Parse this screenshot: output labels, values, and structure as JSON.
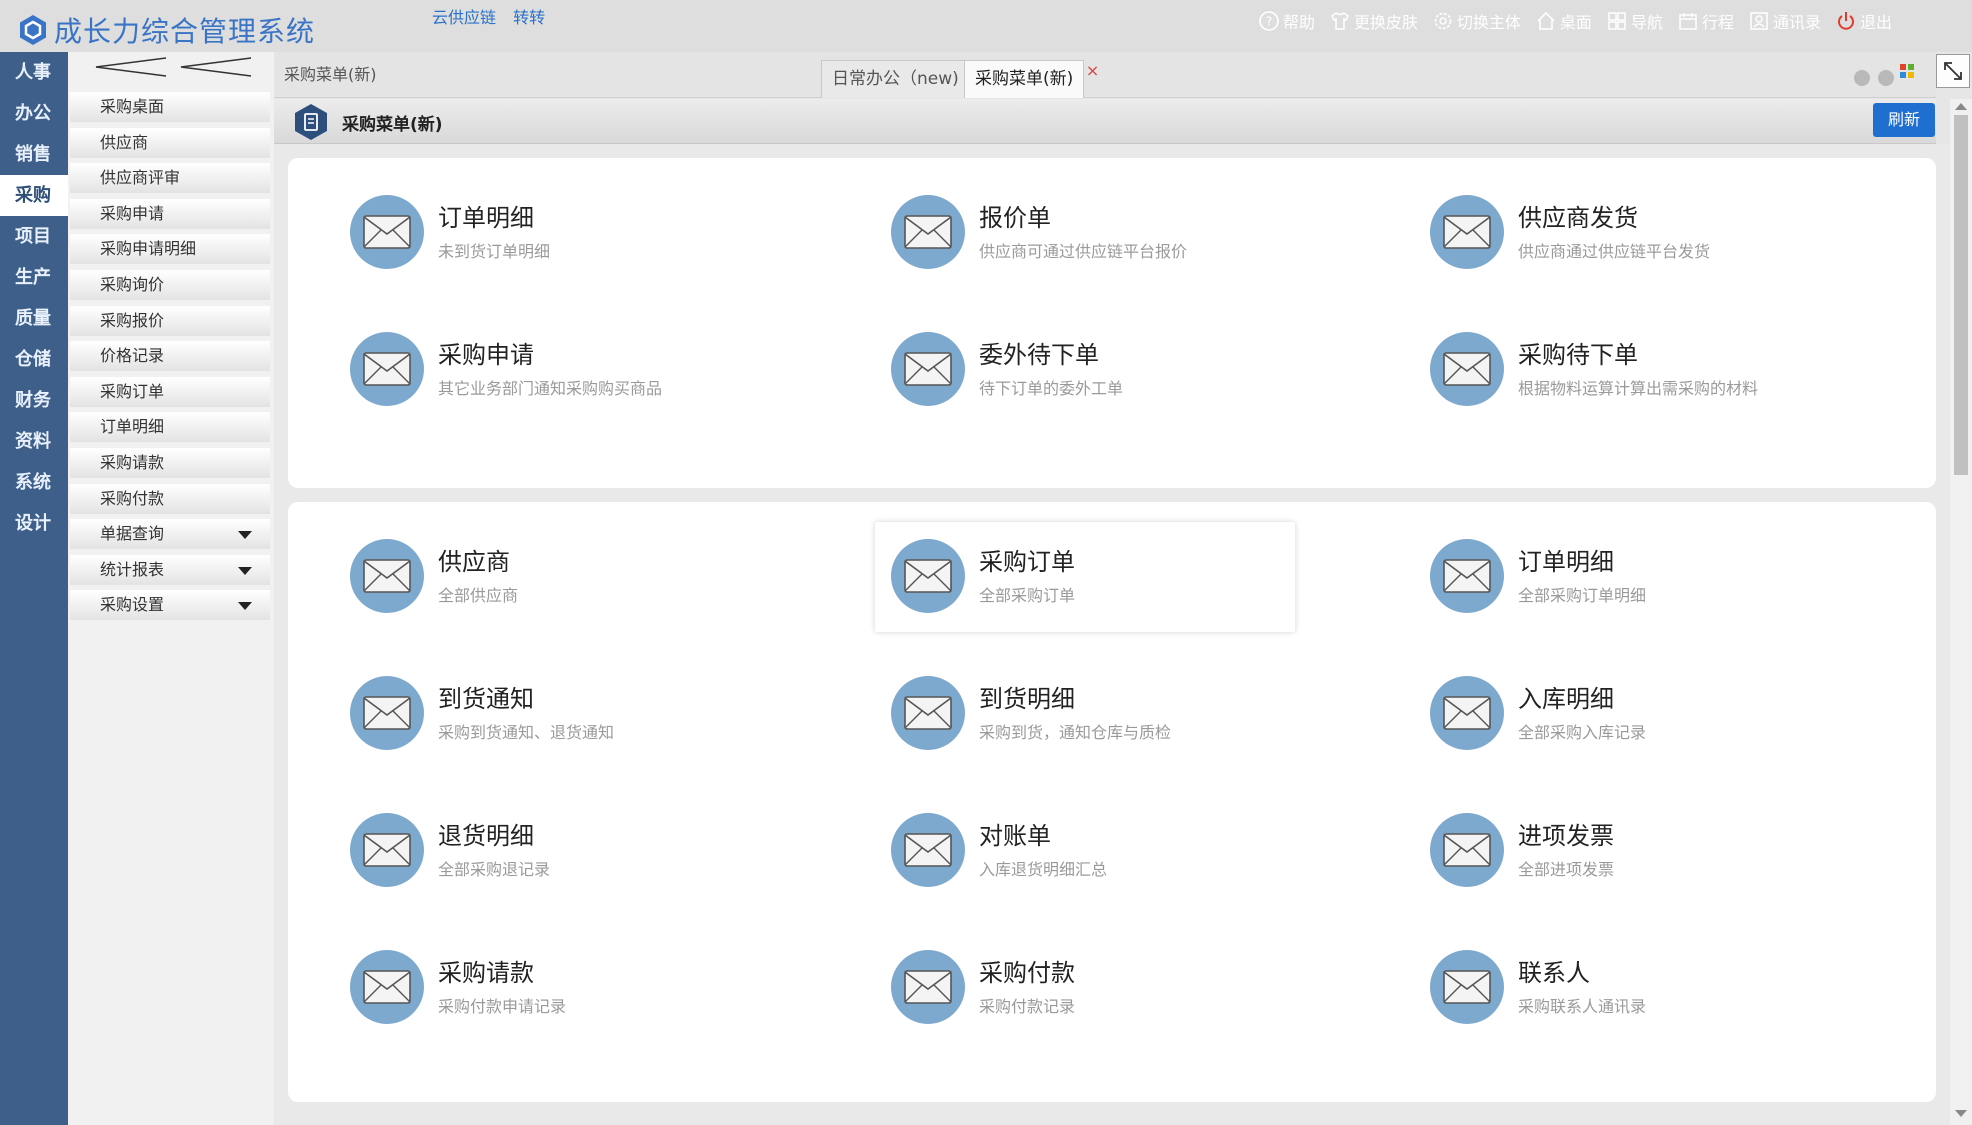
{
  "app": {
    "title": "成长力综合管理系统",
    "brand_color": "#3a74c6",
    "top_links": [
      "云供应链",
      "转转"
    ],
    "top_menu": [
      {
        "label": "帮助",
        "icon": "help-icon"
      },
      {
        "label": "更换皮肤",
        "icon": "shirt-icon"
      },
      {
        "label": "切换主体",
        "icon": "gear-icon"
      },
      {
        "label": "桌面",
        "icon": "home-icon"
      },
      {
        "label": "导航",
        "icon": "grid-icon"
      },
      {
        "label": "行程",
        "icon": "calendar-icon"
      },
      {
        "label": "通讯录",
        "icon": "contact-icon"
      },
      {
        "label": "退出",
        "icon": "power-icon"
      }
    ]
  },
  "left_nav": {
    "items": [
      "人事",
      "办公",
      "销售",
      "采购",
      "项目",
      "生产",
      "质量",
      "仓储",
      "财务",
      "资料",
      "系统",
      "设计"
    ],
    "active": "采购"
  },
  "sub_menu": {
    "items": [
      {
        "label": "采购桌面",
        "expandable": false
      },
      {
        "label": "供应商",
        "expandable": false
      },
      {
        "label": "供应商评审",
        "expandable": false
      },
      {
        "label": "采购申请",
        "expandable": false
      },
      {
        "label": "采购申请明细",
        "expandable": false
      },
      {
        "label": "采购询价",
        "expandable": false
      },
      {
        "label": "采购报价",
        "expandable": false
      },
      {
        "label": "价格记录",
        "expandable": false
      },
      {
        "label": "采购订单",
        "expandable": false
      },
      {
        "label": "订单明细",
        "expandable": false
      },
      {
        "label": "采购请款",
        "expandable": false
      },
      {
        "label": "采购付款",
        "expandable": false
      },
      {
        "label": "单据查询",
        "expandable": true
      },
      {
        "label": "统计报表",
        "expandable": true
      },
      {
        "label": "采购设置",
        "expandable": true
      }
    ]
  },
  "tabbar": {
    "path": "采购菜单(新)",
    "tabs": [
      {
        "label": "日常办公（new)",
        "active": false
      },
      {
        "label": "采购菜单(新)",
        "active": true,
        "close": "×"
      }
    ]
  },
  "page": {
    "title": "采购菜单(新)",
    "refresh_label": "刷新"
  },
  "panels": [
    {
      "cards": [
        {
          "title": "订单明细",
          "desc": "未到货订单明细"
        },
        {
          "title": "报价单",
          "desc": "供应商可通过供应链平台报价"
        },
        {
          "title": "供应商发货",
          "desc": "供应商通过供应链平台发货"
        },
        {
          "title": "采购申请",
          "desc": "其它业务部门通知采购购买商品"
        },
        {
          "title": "委外待下单",
          "desc": "待下订单的委外工单"
        },
        {
          "title": "采购待下单",
          "desc": "根据物料运算计算出需采购的材料"
        }
      ]
    },
    {
      "cards": [
        {
          "title": "供应商",
          "desc": "全部供应商"
        },
        {
          "title": "采购订单",
          "desc": "全部采购订单",
          "highlighted": true
        },
        {
          "title": "订单明细",
          "desc": "全部采购订单明细"
        },
        {
          "title": "到货通知",
          "desc": "采购到货通知、退货通知"
        },
        {
          "title": "到货明细",
          "desc": "采购到货，通知仓库与质检"
        },
        {
          "title": "入库明细",
          "desc": "全部采购入库记录"
        },
        {
          "title": "退货明细",
          "desc": "全部采购退记录"
        },
        {
          "title": "对账单",
          "desc": "入库退货明细汇总"
        },
        {
          "title": "进项发票",
          "desc": "全部进项发票"
        },
        {
          "title": "采购请款",
          "desc": "采购付款申请记录"
        },
        {
          "title": "采购付款",
          "desc": "采购付款记录"
        },
        {
          "title": "联系人",
          "desc": "采购联系人通讯录"
        }
      ]
    }
  ]
}
